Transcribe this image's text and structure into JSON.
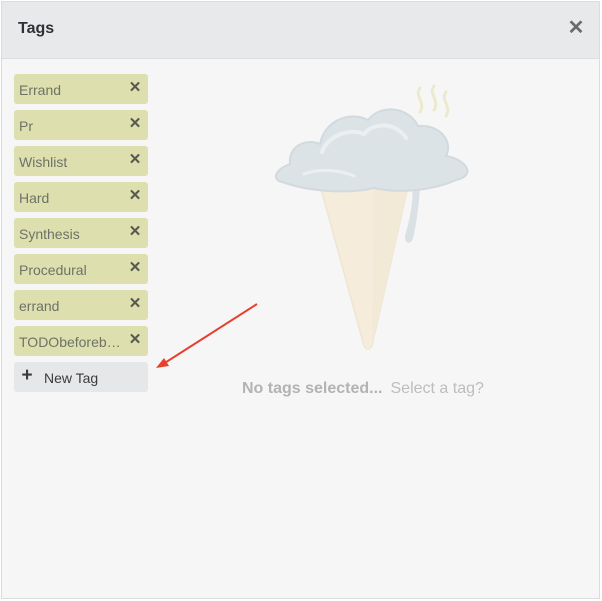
{
  "header": {
    "title": "Tags",
    "close_icon": "close-icon",
    "close_glyph": "✕"
  },
  "tags": [
    {
      "label": "Errand"
    },
    {
      "label": "Pr"
    },
    {
      "label": "Wishlist"
    },
    {
      "label": "Hard"
    },
    {
      "label": "Synthesis"
    },
    {
      "label": "Procedural"
    },
    {
      "label": "errand"
    },
    {
      "label": "TODObeforebr…"
    }
  ],
  "tag_remove_glyph": "✕",
  "new_tag": {
    "label": "New Tag",
    "icon": "plus-icon",
    "glyph": "+"
  },
  "empty_state": {
    "title": "No tags selected...",
    "subtitle": "Select a tag?",
    "illustration": "melting-ice-cream-cone-illustration"
  },
  "colors": {
    "tag_bg": "#dde0ae",
    "header_bg": "#e8e9ea",
    "annotation_arrow": "#e8402f"
  }
}
